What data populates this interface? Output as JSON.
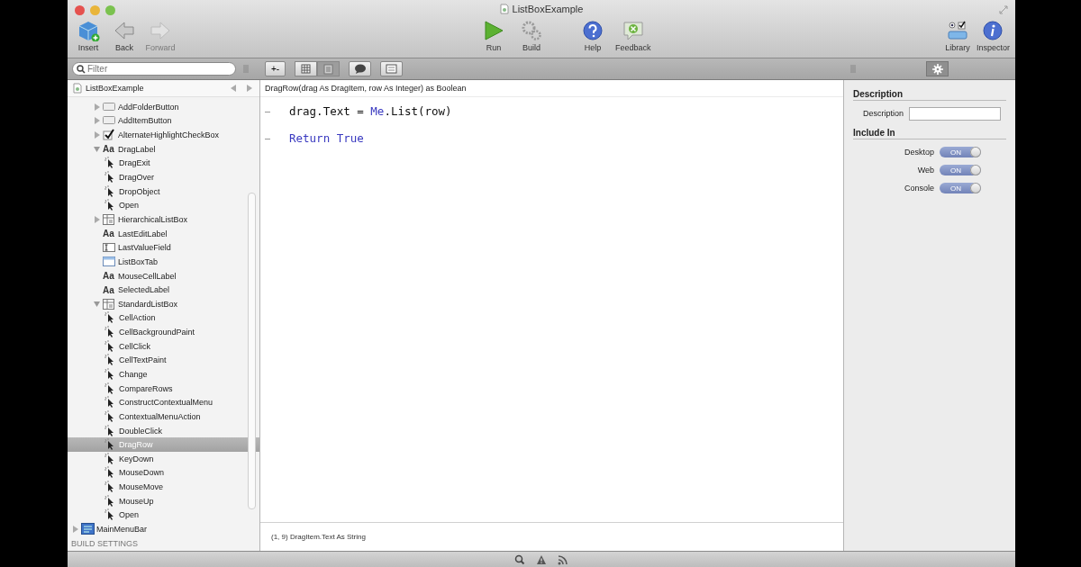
{
  "window": {
    "title": "ListBoxExample"
  },
  "toolbar": {
    "left": [
      {
        "label": "Insert",
        "kind": "insert",
        "disabled": false
      },
      {
        "label": "Back",
        "kind": "back",
        "disabled": false
      },
      {
        "label": "Forward",
        "kind": "forward",
        "disabled": true
      }
    ],
    "center": [
      {
        "label": "Run",
        "kind": "run",
        "disabled": false
      },
      {
        "label": "Build",
        "kind": "build",
        "disabled": false
      },
      {
        "label": "Help",
        "kind": "help",
        "disabled": false
      },
      {
        "label": "Feedback",
        "kind": "feedback",
        "disabled": false
      }
    ],
    "right": [
      {
        "label": "Library",
        "kind": "library",
        "disabled": false
      },
      {
        "label": "Inspector",
        "kind": "inspector",
        "disabled": false
      }
    ]
  },
  "filter": {
    "placeholder": "Filter"
  },
  "add_remove_button": {
    "label": "+-"
  },
  "view_segments": [
    {
      "kind": "grid",
      "selected": false
    },
    {
      "kind": "list",
      "selected": true
    }
  ],
  "inspector_tabs": [
    {
      "kind": "gear",
      "selected": true
    }
  ],
  "navigator": {
    "title": "ListBoxExample",
    "items": [
      {
        "name": "AddFolderButton",
        "kind": "pushbutton",
        "expanded": false,
        "selected": false
      },
      {
        "name": "AddItemButton",
        "kind": "pushbutton",
        "expanded": false,
        "selected": false
      },
      {
        "name": "AlternateHighlightCheckBox",
        "kind": "checkbox",
        "expanded": false,
        "selected": false
      },
      {
        "name": "DragLabel",
        "kind": "label",
        "glyph": "Aa",
        "expanded": true,
        "selected": false,
        "children": [
          {
            "name": "DragExit",
            "kind": "event",
            "selected": false
          },
          {
            "name": "DragOver",
            "kind": "event",
            "selected": false
          },
          {
            "name": "DropObject",
            "kind": "event",
            "selected": false
          },
          {
            "name": "Open",
            "kind": "event",
            "selected": false
          }
        ]
      },
      {
        "name": "HierarchicalListBox",
        "kind": "listbox",
        "expanded": false,
        "selected": false
      },
      {
        "name": "LastEditLabel",
        "kind": "label",
        "glyph": "Aa",
        "selected": false
      },
      {
        "name": "LastValueField",
        "kind": "field",
        "selected": false
      },
      {
        "name": "ListBoxTab",
        "kind": "tabpanel",
        "selected": false
      },
      {
        "name": "MouseCellLabel",
        "kind": "label",
        "glyph": "Aa",
        "selected": false
      },
      {
        "name": "SelectedLabel",
        "kind": "label",
        "glyph": "Aa",
        "selected": false
      },
      {
        "name": "StandardListBox",
        "kind": "listbox",
        "expanded": true,
        "selected": false,
        "children": [
          {
            "name": "CellAction",
            "kind": "event",
            "selected": false
          },
          {
            "name": "CellBackgroundPaint",
            "kind": "event",
            "selected": false
          },
          {
            "name": "CellClick",
            "kind": "event",
            "selected": false
          },
          {
            "name": "CellTextPaint",
            "kind": "event",
            "selected": false
          },
          {
            "name": "Change",
            "kind": "event",
            "selected": false
          },
          {
            "name": "CompareRows",
            "kind": "event",
            "selected": false
          },
          {
            "name": "ConstructContextualMenu",
            "kind": "event",
            "selected": false
          },
          {
            "name": "ContextualMenuAction",
            "kind": "event",
            "selected": false
          },
          {
            "name": "DoubleClick",
            "kind": "event",
            "selected": false
          },
          {
            "name": "DragRow",
            "kind": "event",
            "selected": true
          },
          {
            "name": "KeyDown",
            "kind": "event",
            "selected": false
          },
          {
            "name": "MouseDown",
            "kind": "event",
            "selected": false
          },
          {
            "name": "MouseMove",
            "kind": "event",
            "selected": false
          },
          {
            "name": "MouseUp",
            "kind": "event",
            "selected": false
          },
          {
            "name": "Open",
            "kind": "event",
            "selected": false
          }
        ]
      }
    ],
    "root_items": [
      {
        "name": "MainMenuBar",
        "kind": "menubar",
        "expanded": false,
        "selected": false
      }
    ],
    "section_heading": "BUILD SETTINGS"
  },
  "editor": {
    "signature": "DragRow(drag As DragItem, row As Integer) as Boolean",
    "lines": [
      {
        "tokens": [
          {
            "text": "drag.Text = ",
            "kind": "plain"
          },
          {
            "text": "Me",
            "kind": "keyword"
          },
          {
            "text": ".List(row)",
            "kind": "plain"
          }
        ]
      },
      {
        "tokens": [
          {
            "text": "Return True",
            "kind": "keyword"
          }
        ]
      }
    ],
    "status": "(1, 9) DragItem.Text As String"
  },
  "inspector": {
    "sections": [
      {
        "title": "Description",
        "rows": [
          {
            "kind": "text",
            "label": "Description"
          }
        ]
      },
      {
        "title": "Include In",
        "rows": [
          {
            "kind": "switch",
            "label": "Desktop",
            "on": true,
            "switch_label": "ON"
          },
          {
            "kind": "switch",
            "label": "Web",
            "on": true,
            "switch_label": "ON"
          },
          {
            "kind": "switch",
            "label": "Console",
            "on": true,
            "switch_label": "ON"
          }
        ]
      }
    ]
  },
  "bottom_bar": [
    {
      "kind": "search"
    },
    {
      "kind": "warning"
    },
    {
      "kind": "feed"
    }
  ]
}
